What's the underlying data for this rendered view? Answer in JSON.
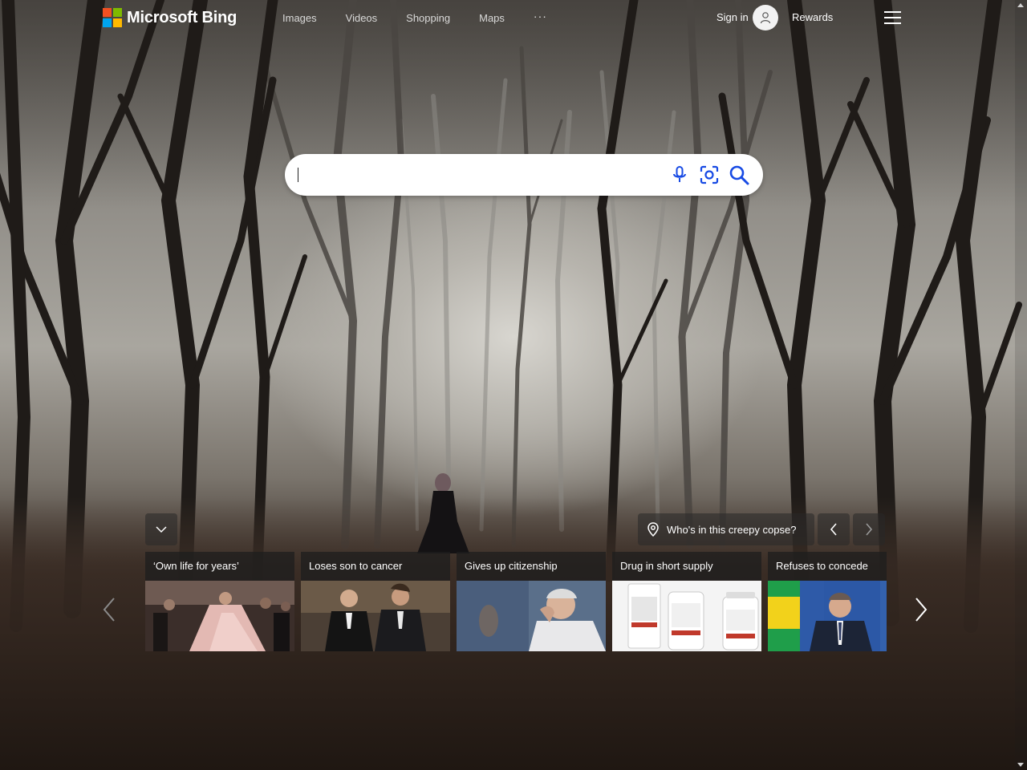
{
  "header": {
    "brand": "Microsoft Bing",
    "nav": [
      "Images",
      "Videos",
      "Shopping",
      "Maps"
    ],
    "more": "···",
    "sign_in": "Sign in",
    "rewards": "Rewards"
  },
  "search": {
    "value": "",
    "placeholder": ""
  },
  "image_of_day": {
    "question": "Who's in this creepy copse?"
  },
  "news": [
    {
      "title": "‘Own life for years’"
    },
    {
      "title": "Loses son to cancer"
    },
    {
      "title": "Gives up citizenship"
    },
    {
      "title": "Drug in short supply"
    },
    {
      "title": "Refuses to concede"
    }
  ],
  "colors": {
    "ms_red": "#f25022",
    "ms_green": "#7fba00",
    "ms_blue": "#00a4ef",
    "ms_yellow": "#ffb900",
    "search_icon_blue": "#174ae4"
  },
  "icons": [
    "microphone-icon",
    "visual-search-icon",
    "search-icon",
    "chevron-down-icon",
    "location-pin-icon",
    "chevron-left-icon",
    "chevron-right-icon",
    "user-icon",
    "hamburger-menu-icon"
  ]
}
